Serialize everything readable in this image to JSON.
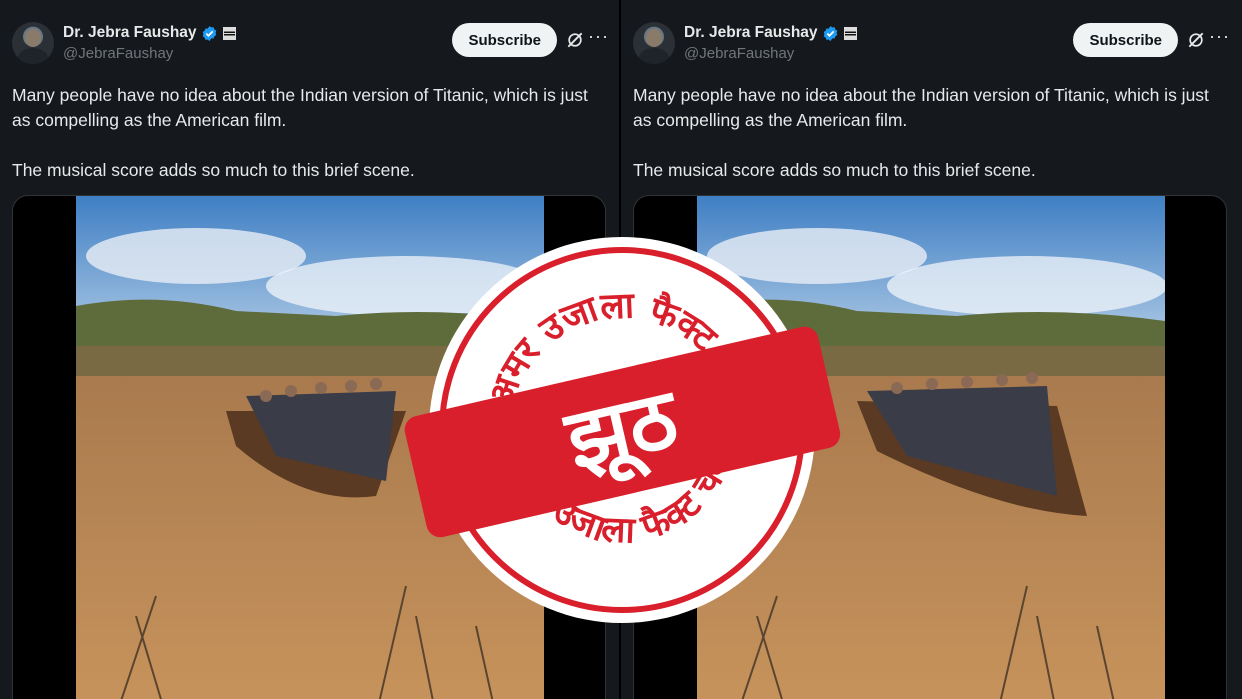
{
  "tweets": [
    {
      "display_name": "Dr. Jebra Faushay",
      "handle": "@JebraFaushay",
      "subscribe_label": "Subscribe",
      "more_label": "···",
      "text_line1": "Many people have no idea about the Indian version of Titanic, which is just as compelling as the American film.",
      "text_line2": "The musical score adds so much to this brief scene."
    },
    {
      "display_name": "Dr. Jebra Faushay",
      "handle": "@JebraFaushay",
      "subscribe_label": "Subscribe",
      "more_label": "···",
      "text_line1": "Many people have no idea about the Indian version of Titanic, which is just as compelling as the American film.",
      "text_line2": "The musical score adds so much to this brief scene."
    }
  ],
  "icons": {
    "verified": "verified-badge-icon",
    "flag": "flag-icon",
    "grok": "grok-icon",
    "more": "more-icon"
  },
  "stamp": {
    "top_text": "अमर उजाला फैक्ट चेक",
    "bottom_text": "अमर उजाला फैक्ट चेक",
    "verdict": "झूठ"
  },
  "colors": {
    "background": "#15181c",
    "verified_blue": "#1d9bf0",
    "stamp_red": "#d91f2b",
    "water": "#b88450"
  }
}
